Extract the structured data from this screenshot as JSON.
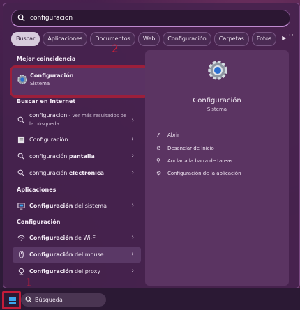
{
  "search": {
    "query": "configuracion"
  },
  "tabs": [
    "Buscar",
    "Aplicaciones",
    "Documentos",
    "Web",
    "Configuración",
    "Carpetas",
    "Fotos"
  ],
  "more_label": "···",
  "sections": {
    "best": "Mejor coincidencia",
    "web": "Buscar en Internet",
    "apps": "Aplicaciones",
    "config": "Configuración"
  },
  "best_match": {
    "title": "Configuración",
    "subtitle": "Sistema"
  },
  "web_results": [
    {
      "term": "configuracion",
      "extra": " - Ver más resultados de la búsqueda"
    },
    {
      "term": "Configuración",
      "extra": ""
    },
    {
      "term": "configuración ",
      "bold": "pantalla"
    },
    {
      "term": "configuración ",
      "bold": "electronica"
    }
  ],
  "apps": [
    {
      "term": "Configuración",
      "rest": " del sistema"
    }
  ],
  "config_items": [
    {
      "term": "Configuración",
      "rest": " de Wi-Fi"
    },
    {
      "term": "Configuración",
      "rest": " del mouse"
    },
    {
      "term": "Configuración",
      "rest": " del proxy"
    }
  ],
  "detail": {
    "title": "Configuración",
    "subtitle": "Sistema",
    "actions": [
      "Abrir",
      "Desanclar de Inicio",
      "Anclar a la barra de tareas",
      "Configuración de la aplicación"
    ]
  },
  "annotations": {
    "one": "1",
    "two": "2"
  },
  "taskbar": {
    "search_label": "Búsqueda"
  },
  "colors": {
    "accent": "#3aa6f0",
    "annotation": "#c21c3a"
  }
}
